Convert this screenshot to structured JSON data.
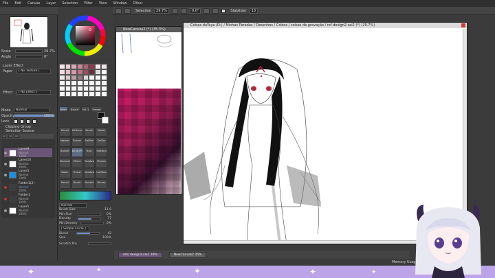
{
  "menu": [
    "File",
    "Edit",
    "Canvas",
    "Layer",
    "Selection",
    "Filter",
    "View",
    "Window",
    "Other"
  ],
  "toolbar": {
    "selection_label": "Selection",
    "zoom": "29.7%",
    "angle": "0.0°",
    "stabilizer_label": "Stabilizer",
    "stabilizer_value": "13"
  },
  "left": {
    "scale_label": "Scale",
    "scale_value": "29.7%",
    "angle_label": "Angle",
    "angle_value": "0°",
    "layer_effect": "Layer Effect",
    "paper_label": "Paper",
    "paper_value": "[ No Texture ]",
    "effect_label": "Effect",
    "effect_value": "[ No Effect ]",
    "mode_label": "Mode",
    "mode_value": "Normal",
    "opacity_label": "Opacity",
    "opacity_value": "100%",
    "lock_label": "Lock",
    "clipping": "Clipping Group",
    "selection_source": "Selection Source",
    "layers": [
      {
        "name": "Layer9",
        "mode": "Normal",
        "opacity": "100%"
      },
      {
        "name": "Layer10",
        "mode": "Normal",
        "opacity": "100%"
      },
      {
        "name": "Layer5",
        "mode": "Normal",
        "opacity": "100%"
      },
      {
        "name": "Folder1(2)",
        "mode": "Normal",
        "opacity": "100%"
      },
      {
        "name": "Folder1",
        "mode": "Normal",
        "opacity": "100%"
      },
      {
        "name": "Layer1",
        "mode": "Normal",
        "opacity": "100%"
      }
    ]
  },
  "palette_colors": [
    "#f3e6e9",
    "#e9cfd6",
    "#d9aab6",
    "#c98797",
    "#b45f73",
    "#8e3a4c",
    "#f4ecef",
    "#efe4e8",
    "#f0d9de",
    "#e4bfc8",
    "#cf9aa8",
    "#bb7385",
    "#9c4d60",
    "#6b2d3a",
    "#dcdcdc",
    "#f5f5f5",
    "#ececec",
    "#d7c8cc",
    "#b6a1a8",
    "#8c7980",
    "#d9d9d9",
    "#f5f5f5",
    "#f5f5f5",
    "#f5f5f5",
    "#f5f5f5",
    "#f5f5f5",
    "#f5f5f5",
    "#f5f5f5",
    "#f5f5f5",
    "#f5f5f5",
    "#f5f5f5",
    "#f5f5f5",
    "#f5f5f5",
    "#f5f5f5",
    "#f5f5f5",
    "#f5f5f5",
    "#f5f5f5",
    "#f5f5f5",
    "#f5f5f5",
    "#f5f5f5",
    "#f5f5f5",
    "#f5f5f5",
    "#f5f5f5",
    "#f5f5f5",
    "#f5f5f5",
    "#f5f5f5",
    "#f5f5f5",
    "#f5f5f5"
  ],
  "tools": {
    "tabs": [
      "Basic",
      "Brush",
      "Ext.1",
      "Smear"
    ],
    "items": [
      "Pencil",
      "AirBrush",
      "Brush",
      "Water",
      "Marker",
      "Eraser",
      "SelPen",
      "SelErs",
      "Bucket",
      "BinaryPen",
      "Blur",
      "Softblur",
      "Decorate",
      "Effect",
      "Shadow",
      "Marker",
      "Basic",
      "Ghost",
      "Shadow",
      "Halftone",
      "Pencil",
      "Brush",
      "Bucket",
      "Binary"
    ]
  },
  "props": {
    "mode": "Normal",
    "brush_size_label": "Brush Size",
    "brush_size_value": "11.0",
    "min_size_label": "Min Size",
    "min_size_value": "0%",
    "density_label": "Density",
    "density_value": "77",
    "min_density_label": "Min Density",
    "min_density_value": "0%",
    "shape_label": "[ Simple Circle ]",
    "blend_label": "Blend",
    "blend_value": "42",
    "size_label": "Size",
    "size_value": "100%",
    "scratch_label": "Scratch Pro"
  },
  "windows": {
    "left_title": "NewCanvas2 (*) (35.3%)",
    "main_title": "Coisas daYaya (D:) / Minhas Paradas / Desenhos / Coloss / coisas da gravação / ref design2.sai2 (*) (29.7%)"
  },
  "navbar": {
    "tab1": "refs design2.sai2",
    "tab1_zoom": "29%",
    "tab2": "NewCanvas2",
    "tab2_zoom": "35%"
  },
  "status": "Memory Usage",
  "colors": {
    "accent": "#6e8fc8",
    "hue_selected": "#c0304a",
    "strip": "#bda4e8"
  }
}
